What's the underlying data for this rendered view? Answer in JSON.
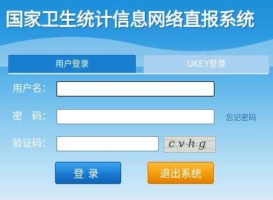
{
  "header": {
    "title": "国家卫生统计信息网络直报系统"
  },
  "tabs": [
    {
      "label": "用户登录",
      "active": true
    },
    {
      "label": "UKEY登录",
      "active": false
    }
  ],
  "form": {
    "username_label": "用户名：",
    "username_value": "",
    "password_label": "密　码：",
    "password_value": "",
    "forgot_label": "忘记密码",
    "captcha_label": "验证码：",
    "captcha_value": "",
    "captcha_image_text": "cvhg"
  },
  "buttons": {
    "login": "登录",
    "exit": "退出系统"
  },
  "colors": {
    "primary_blue": "#1a7fd0",
    "exit_orange": "#f39b07",
    "link": "#2d6ea8"
  }
}
